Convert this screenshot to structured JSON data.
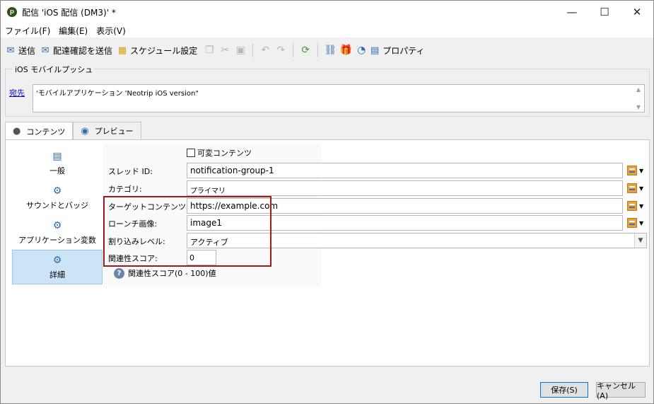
{
  "window": {
    "title": "配信 'iOS 配信 (DM3)' *",
    "app_icon_glyph": "p",
    "minimize": "—",
    "maximize": "☐",
    "close": "✕"
  },
  "menu": [
    {
      "label": "ファイル(F)"
    },
    {
      "label": "編集(E)"
    },
    {
      "label": "表示(V)"
    }
  ],
  "toolbar": {
    "send_label": "送信",
    "confirm_send_label": "配達確認を送信",
    "schedule_label": "スケジュール設定",
    "properties_label": "プロパティ"
  },
  "push_group": {
    "label": "iOS モバイルプッシュ",
    "to_link": "宛先",
    "to_value": "'モバイルアプリケーション 'Neotrip iOS version\""
  },
  "tabs": [
    {
      "label": "コンテンツ",
      "active": true
    },
    {
      "label": "プレビュー",
      "active": false
    }
  ],
  "sidebar": [
    {
      "label": "一般",
      "selected": false
    },
    {
      "label": "サウンドとバッジ",
      "selected": false
    },
    {
      "label": "アプリケーション変数",
      "selected": false
    },
    {
      "label": "詳細",
      "selected": true
    }
  ],
  "form": {
    "mutable_content_label": "可変コンテンツ",
    "mutable_content_checked": false,
    "thread_id_label": "スレッド ID:",
    "thread_id_value": "notification-group-1",
    "category_label": "カテゴリ:",
    "category_value": "プライマリ",
    "target_content_label": "ターゲットコンテンツ ID:",
    "target_content_value": "https://example.com",
    "launch_image_label": "ローンチ画像:",
    "launch_image_value": "image1",
    "interruption_label": "割り込みレベル:",
    "interruption_value": "アクティブ",
    "relevance_label": "関連性スコア:",
    "relevance_value": "0",
    "help_text": "関連性スコア(0 - 100)値"
  },
  "buttons": {
    "save": "保存(S)",
    "cancel": "キャンセル(A)"
  },
  "colors": {
    "highlight_border": "#a11a1a",
    "selected_bg": "#cce4f7",
    "link": "#0000ee"
  }
}
